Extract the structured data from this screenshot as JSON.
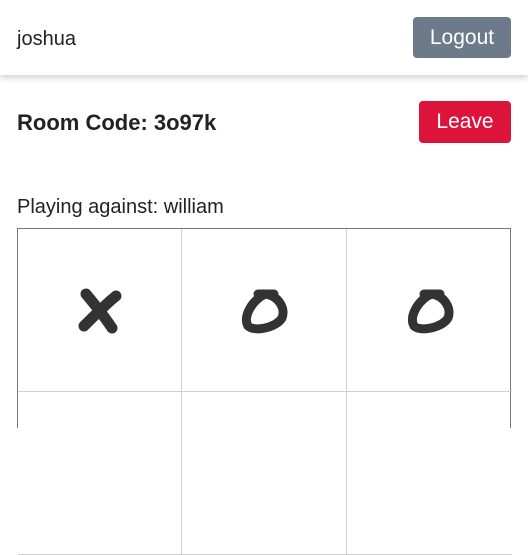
{
  "header": {
    "username": "joshua",
    "logout_label": "Logout"
  },
  "room": {
    "title": "Room Code: 3o97k",
    "leave_label": "Leave"
  },
  "game": {
    "opponent_text": "Playing against: william",
    "board": [
      [
        "X",
        "O",
        "O"
      ],
      [
        "",
        "",
        ""
      ]
    ]
  },
  "colors": {
    "logout_button": "#6c7a89",
    "leave_button": "#dc143c",
    "mark": "#333333"
  }
}
